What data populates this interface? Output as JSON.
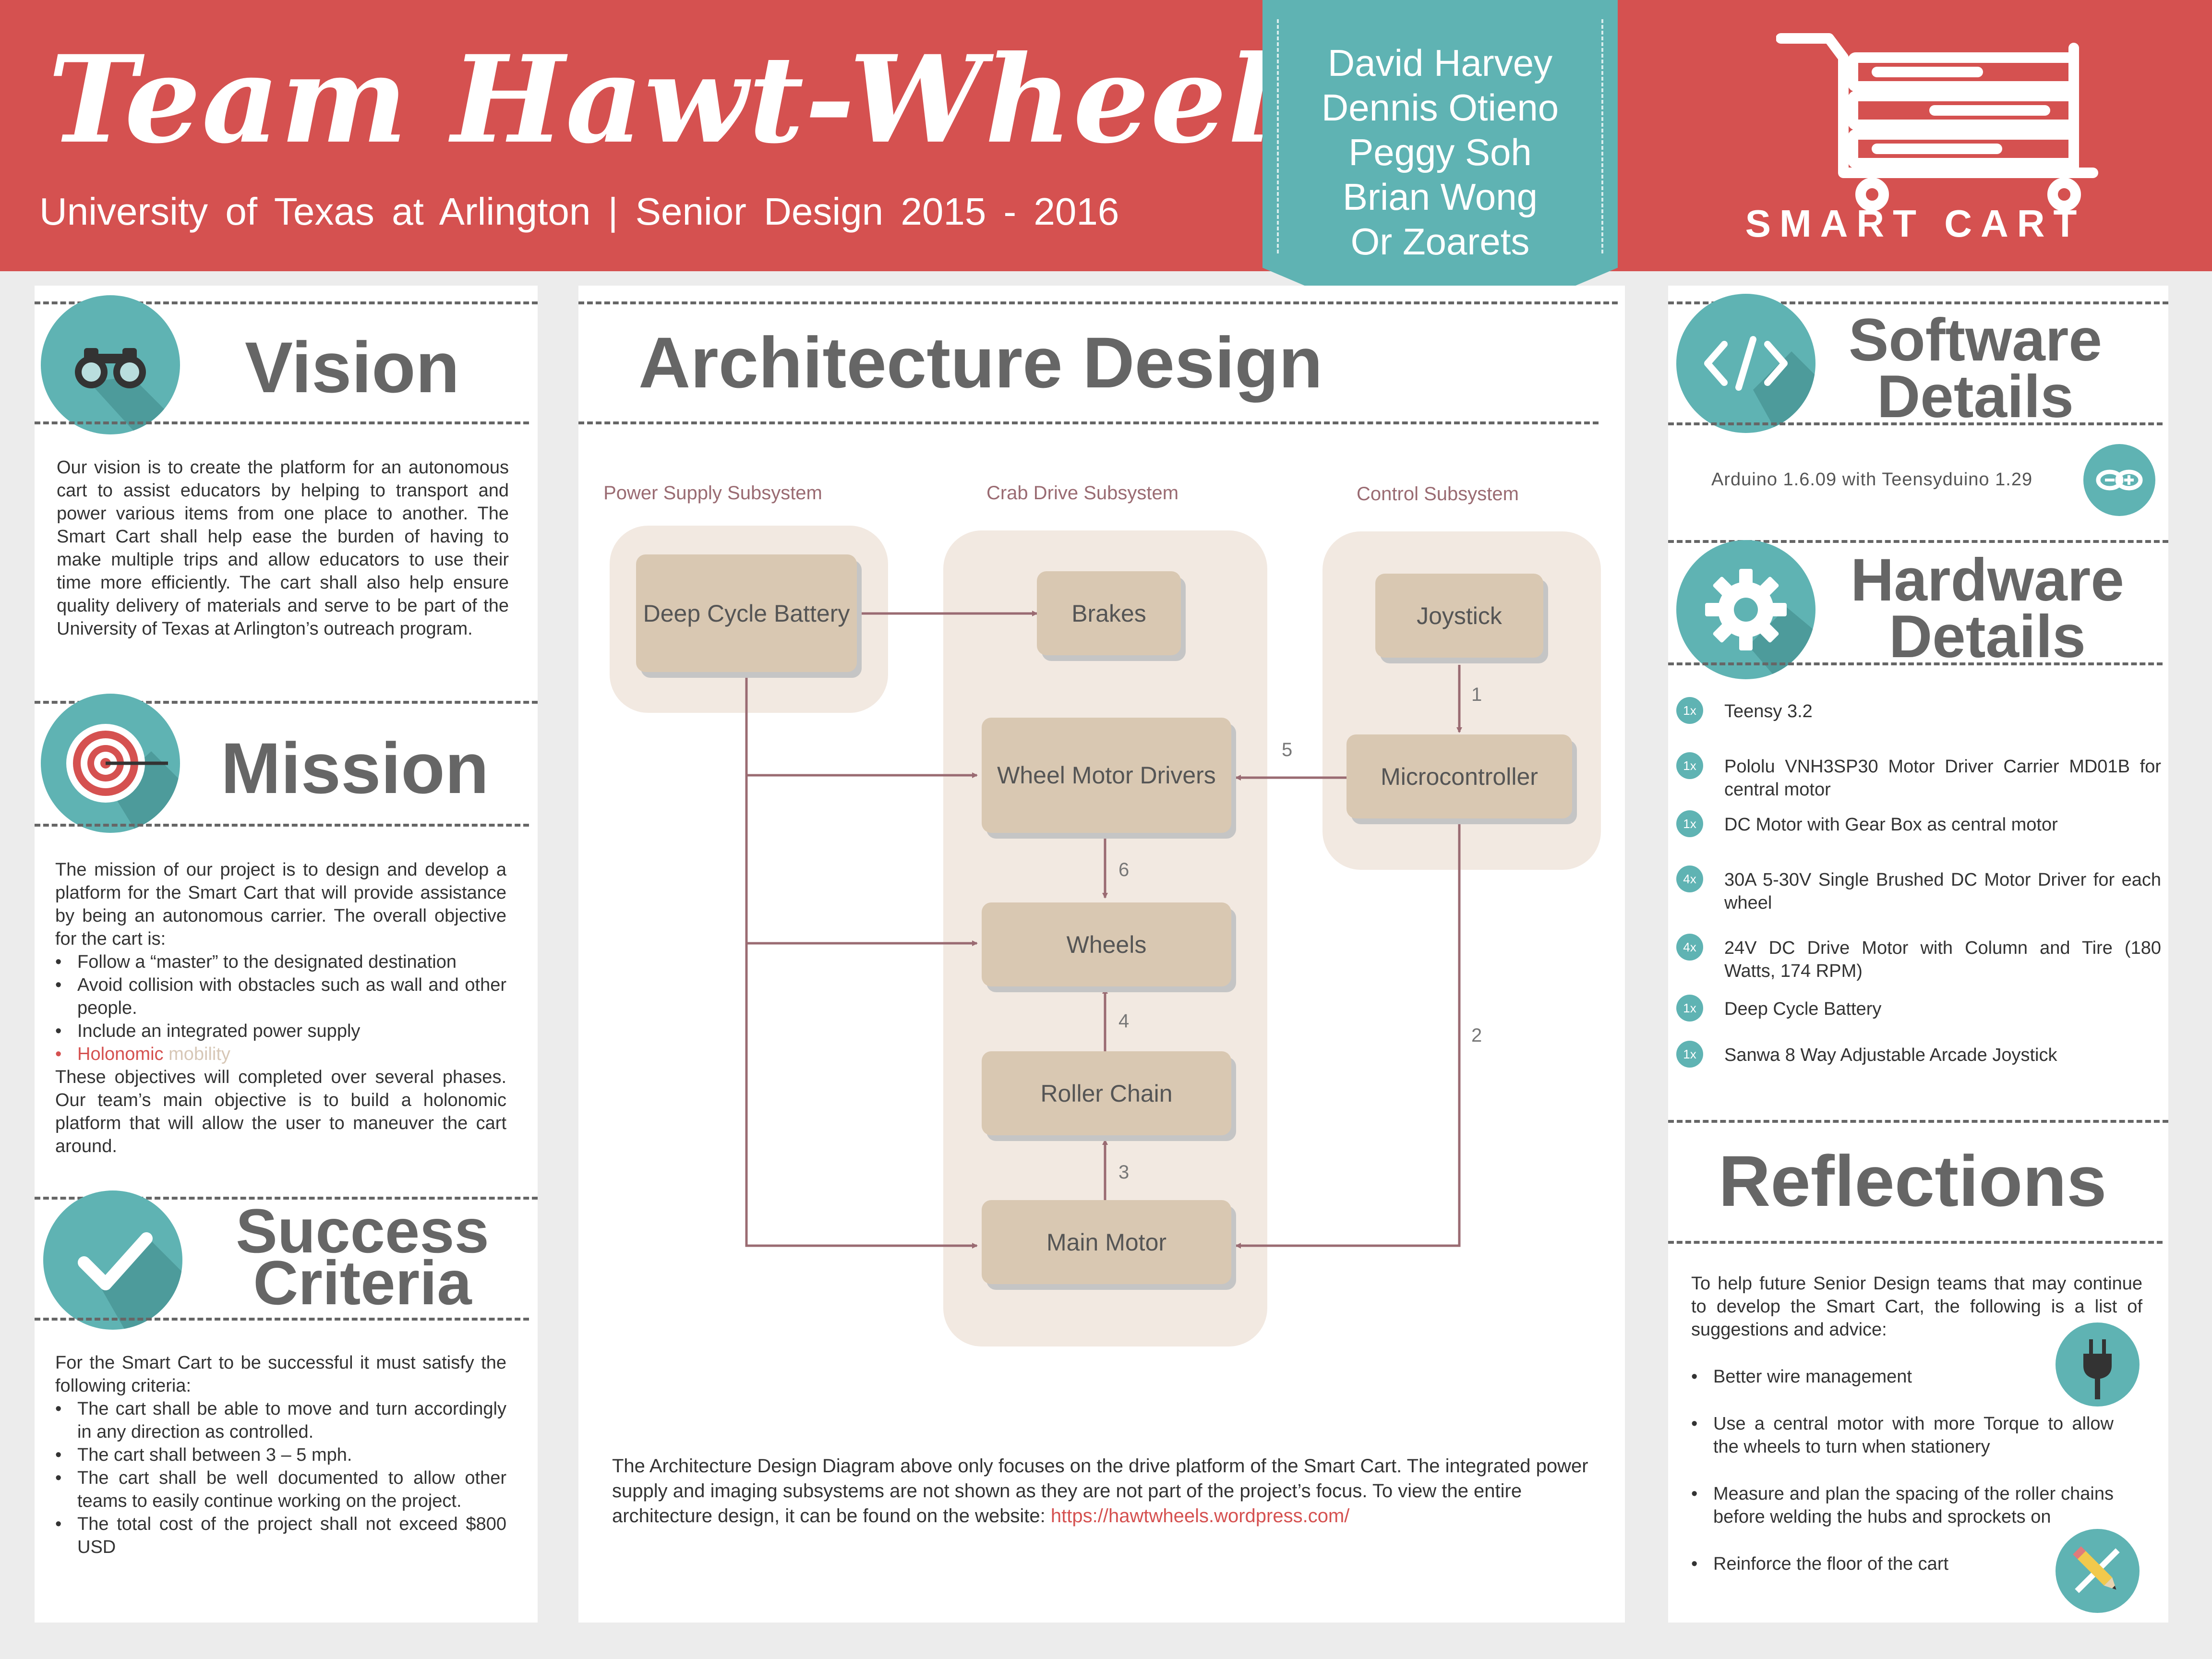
{
  "header": {
    "team_title": "Team Hawt-Wheels",
    "subtitle": "University of Texas at Arlington | Senior Design 2015 - 2016",
    "members": [
      "David Harvey",
      "Dennis Otieno",
      "Peggy Soh",
      "Brian Wong",
      "Or Zoarets"
    ],
    "logo_text": "SMART CART"
  },
  "colors": {
    "header_red": "#d55150",
    "teal": "#5fb3b3",
    "node_tan": "#d9c8b2",
    "region_beige": "#f2e9e1",
    "edge": "#9a6b72"
  },
  "vision": {
    "title": "Vision",
    "icon": "binoculars-icon",
    "text": "Our vision is to create the platform for an autonomous cart to assist educators by helping to transport and power various items from one place to another. The Smart Cart shall help ease the burden of having to make multiple trips and allow educators to use their time more efficiently. The cart shall also help ensure quality delivery of materials and serve to be part of the University of Texas at Arlington’s outreach program."
  },
  "mission": {
    "title": "Mission",
    "icon": "target-icon",
    "intro": "The mission of our project is to design and develop a platform for the Smart Cart that will provide assistance by being an autonomous carrier. The overall objective for the cart is:",
    "items": [
      "Follow a “master” to the designated destination",
      "Avoid collision with obstacles such as wall and other people.",
      "Include an integrated power supply"
    ],
    "highlight_item": "Holonomic",
    "highlight_item_muted": "mobility",
    "outro": "These objectives will completed over several phases. Our team’s main objective is to build a holonomic platform that will allow the user to maneuver the cart around."
  },
  "success": {
    "title_line1": "Success",
    "title_line2": "Criteria",
    "icon": "checkmark-icon",
    "intro": "For the Smart Cart to be successful it must satisfy the following criteria:",
    "items": [
      "The cart shall be able to move and turn accordingly in any direction as controlled.",
      "The cart shall between 3 – 5 mph.",
      "The cart shall be well documented to allow other teams to easily continue working on the project.",
      "The total cost of the project shall not exceed $800 USD"
    ]
  },
  "architecture": {
    "title": "Architecture Design",
    "subsystems": {
      "power": "Power Supply Subsystem",
      "crab": "Crab Drive Subsystem",
      "control": "Control Subsystem"
    },
    "nodes": {
      "battery": "Deep Cycle Battery",
      "brakes": "Brakes",
      "joystick": "Joystick",
      "microcontroller": "Microcontroller",
      "wheel_motor_drivers": "Wheel Motor Drivers",
      "wheels": "Wheels",
      "roller_chain": "Roller Chain",
      "main_motor": "Main Motor"
    },
    "edge_labels": [
      "1",
      "2",
      "3",
      "4",
      "5",
      "6"
    ],
    "caption": "The Architecture Design Diagram above only focuses on the drive platform of the Smart Cart. The integrated power supply and imaging subsystems are not shown as they are not part of the project’s focus. To view the entire architecture design, it can be found on the website:",
    "link": "https://hawtwheels.wordpress.com/"
  },
  "software": {
    "title_line1": "Software",
    "title_line2": "Details",
    "icon": "code-icon",
    "text": "Arduino 1.6.09 with Teensyduino 1.29",
    "badge_icon": "arduino-icon"
  },
  "hardware": {
    "title_line1": "Hardware",
    "title_line2": "Details",
    "icon": "gear-icon",
    "items": [
      {
        "qty": "1x",
        "text": "Teensy 3.2"
      },
      {
        "qty": "1x",
        "text": "Pololu VNH3SP30 Motor Driver Carrier MD01B for central motor"
      },
      {
        "qty": "1x",
        "text": "DC Motor with Gear Box as central motor"
      },
      {
        "qty": "4x",
        "text": "30A 5-30V Single Brushed DC Motor Driver for each wheel"
      },
      {
        "qty": "4x",
        "text": "24V DC Drive Motor with Column and Tire (180 Watts, 174 RPM)"
      },
      {
        "qty": "1x",
        "text": "Deep Cycle Battery"
      },
      {
        "qty": "1x",
        "text": "Sanwa 8 Way Adjustable Arcade Joystick"
      }
    ]
  },
  "reflections": {
    "title": "Reflections",
    "intro": "To help future Senior Design teams that may continue to develop the Smart Cart, the following is a list of suggestions and advice:",
    "items": [
      "Better wire management",
      "Use a central motor with more Torque to allow the wheels to turn when stationery",
      "Measure and plan the spacing of the roller chains before welding the hubs and sprockets on",
      "Reinforce the floor of the cart"
    ],
    "icons": [
      "plug-icon",
      "pencil-icon"
    ]
  }
}
